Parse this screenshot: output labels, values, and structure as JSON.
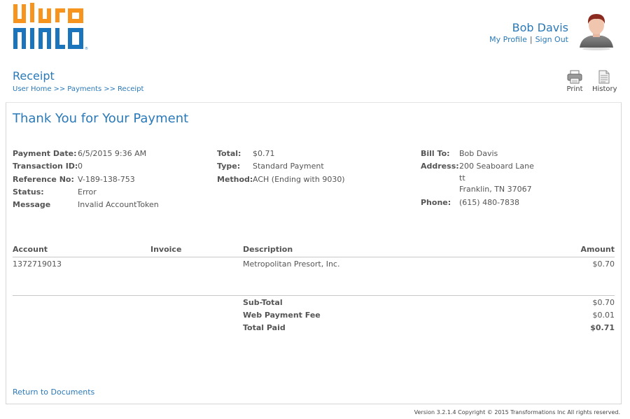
{
  "brand": {
    "logo_text": "uluro",
    "primary_color": "#f7941d",
    "secondary_color": "#1b75bc"
  },
  "user": {
    "name": "Bob Davis",
    "my_profile": "My Profile",
    "link_sep": "|",
    "sign_out": "Sign Out",
    "avatar_icon": "person-avatar-icon"
  },
  "page": {
    "title": "Receipt",
    "breadcrumb": [
      "User Home",
      "Payments",
      "Receipt"
    ],
    "breadcrumb_sep": ">>"
  },
  "toolbar": {
    "print_label": "Print",
    "history_label": "History"
  },
  "receipt": {
    "heading": "Thank You for Your Payment",
    "col1": [
      {
        "label": "Payment Date:",
        "value": "6/5/2015 9:36 AM"
      },
      {
        "label": "Transaction ID:",
        "value": "0"
      },
      {
        "label": "Reference No:",
        "value": "V-189-138-753"
      },
      {
        "label": "Status:",
        "value": "Error"
      },
      {
        "label": "Message",
        "value": "Invalid AccountToken"
      }
    ],
    "col2": [
      {
        "label": "Total:",
        "value": "$0.71"
      },
      {
        "label": "Type:",
        "value": "Standard Payment"
      },
      {
        "label": "Method:",
        "value": "ACH (Ending with 9030)"
      }
    ],
    "bill_to": {
      "label": "Bill To:",
      "value": "Bob Davis",
      "address_label": "Address:",
      "address_lines": [
        "200 Seaboard Lane",
        "tt",
        "Franklin, TN 37067"
      ],
      "phone_label": "Phone:",
      "phone": "(615) 480-7838"
    }
  },
  "table": {
    "headers": {
      "account": "Account",
      "invoice": "Invoice",
      "description": "Description",
      "amount": "Amount"
    },
    "rows": [
      {
        "account": "1372719013",
        "invoice": "",
        "description": "Metropolitan Presort, Inc.",
        "amount": "$0.70"
      }
    ],
    "totals": [
      {
        "label": "Sub-Total",
        "value": "$0.70"
      },
      {
        "label": "Web Payment Fee",
        "value": "$0.01"
      },
      {
        "label": "Total Paid",
        "value": "$0.71"
      }
    ]
  },
  "links": {
    "return": "Return to Documents"
  },
  "footer": {
    "text": "Version 3.2.1.4 Copyright © 2015 Transformations Inc All rights reserved."
  }
}
